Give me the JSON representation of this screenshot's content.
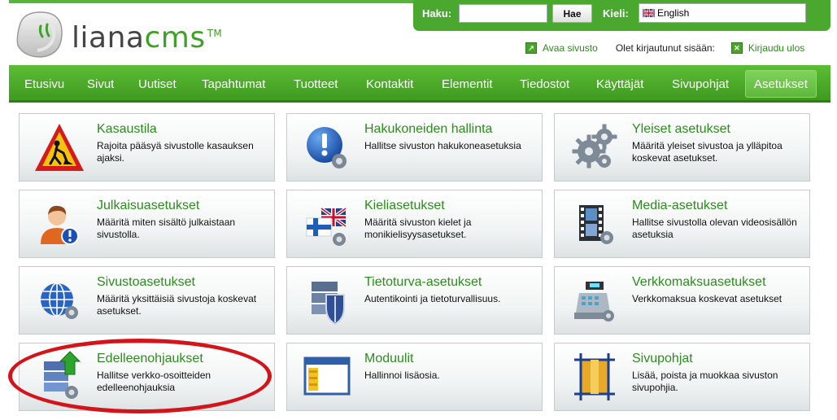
{
  "logo": {
    "brand": "liana",
    "product": "cms",
    "tm": "TM"
  },
  "search": {
    "label": "Haku:",
    "value": "",
    "button": "Hae",
    "lang_label": "Kieli:",
    "lang_value": "English"
  },
  "userbar": {
    "open_site": "Avaa sivusto",
    "status": "Olet kirjautunut sisään:",
    "logout": "Kirjaudu ulos"
  },
  "nav": {
    "items": [
      "Etusivu",
      "Sivut",
      "Uutiset",
      "Tapahtumat",
      "Tuotteet",
      "Kontaktit",
      "Elementit",
      "Tiedostot",
      "Käyttäjät",
      "Sivupohjat",
      "Asetukset"
    ],
    "active": "Asetukset"
  },
  "cards": [
    {
      "title": "Kasaustila",
      "desc": "Rajoita pääsyä sivustolle kasauksen ajaksi.",
      "icon": "construction-icon"
    },
    {
      "title": "Hakukoneiden hallinta",
      "desc": "Hallitse sivuston hakukoneasetuksia",
      "icon": "search-engine-icon"
    },
    {
      "title": "Yleiset asetukset",
      "desc": "Määritä yleiset sivustoa ja ylläpitoa koskevat asetukset.",
      "icon": "gears-icon"
    },
    {
      "title": "Julkaisuasetukset",
      "desc": "Määritä miten sisältö julkaistaan sivustolla.",
      "icon": "user-publish-icon"
    },
    {
      "title": "Kieliasetukset",
      "desc": "Määritä sivuston kielet ja monikielisyysasetukset.",
      "icon": "flags-icon"
    },
    {
      "title": "Media-asetukset",
      "desc": "Hallitse sivustolla olevan videosisällön asetuksia",
      "icon": "film-icon"
    },
    {
      "title": "Sivustoasetukset",
      "desc": "Määritä yksittäisiä sivustoja koskevat asetukset.",
      "icon": "globe-icon"
    },
    {
      "title": "Tietoturva-asetukset",
      "desc": "Autentikointi ja tietoturvallisuus.",
      "icon": "shield-server-icon"
    },
    {
      "title": "Verkkomaksuasetukset",
      "desc": "Verkkomaksua koskevat asetukset",
      "icon": "cash-register-icon"
    },
    {
      "title": "Edelleenohjaukset",
      "desc": "Hallitse verkko-osoitteiden edelleenohjauksia",
      "icon": "redirect-server-icon"
    },
    {
      "title": "Moduulit",
      "desc": "Hallinnoi lisäosia.",
      "icon": "window-modules-icon"
    },
    {
      "title": "Sivupohjat",
      "desc": "Lisää, poista ja muokkaa sivuston sivupohjia.",
      "icon": "template-layout-icon"
    }
  ],
  "colors": {
    "green": "#4ba82f",
    "link_green": "#2e8b1f",
    "highlight_red": "#d3141b"
  }
}
